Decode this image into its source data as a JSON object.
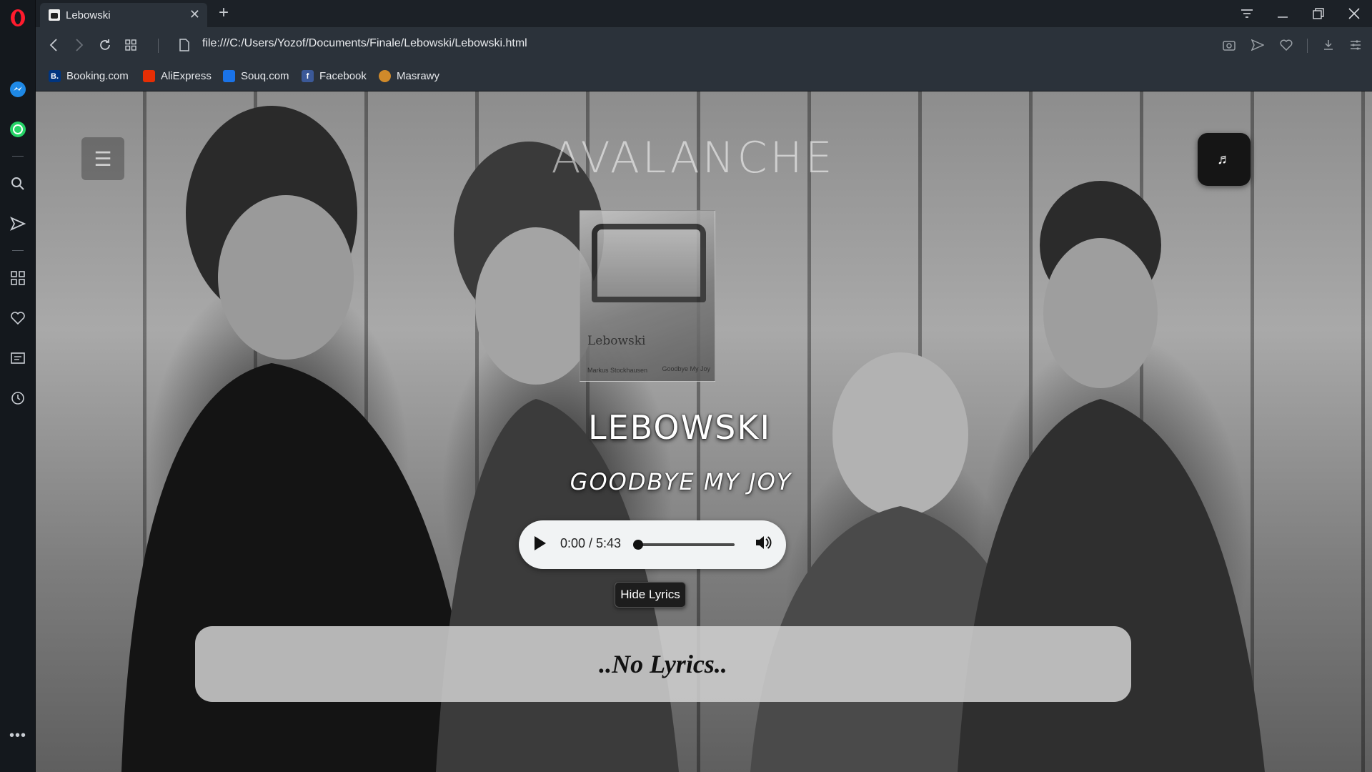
{
  "browser": {
    "tab": {
      "title": "Lebowski",
      "close": "✕"
    },
    "new_tab": "+",
    "url": "file:///C:/Users/Yozof/Documents/Finale/Lebowski/Lebowski.html",
    "bookmarks": [
      {
        "label": "Booking.com",
        "icon": "booking-icon",
        "glyph": "B.",
        "color": "#003580"
      },
      {
        "label": "AliExpress",
        "icon": "aliexpress-icon",
        "glyph": "",
        "color": "#e62e04"
      },
      {
        "label": "Souq.com",
        "icon": "souq-icon",
        "glyph": "",
        "color": "#1a73e8"
      },
      {
        "label": "Facebook",
        "icon": "facebook-icon",
        "glyph": "f",
        "color": "#3b5998"
      },
      {
        "label": "Masrawy",
        "icon": "masrawy-icon",
        "glyph": "",
        "color": "#d08a2a"
      }
    ]
  },
  "page": {
    "site_title": "AVALANCHE",
    "cover": {
      "name": "Lebowski",
      "credit": "Markus Stockhausen",
      "song": "Goodbye My Joy"
    },
    "artist": "LEBOWSKI",
    "song": "GOODBYE MY JOY",
    "player": {
      "time": "0:00 / 5:43",
      "progress": 0
    },
    "lyrics_button": "Hide Lyrics",
    "lyrics_text": "..No Lyrics.."
  },
  "colors": {
    "accent_opera": "#ff1b2d",
    "sidebar": "#14181d",
    "toolbar": "#2b323a"
  }
}
